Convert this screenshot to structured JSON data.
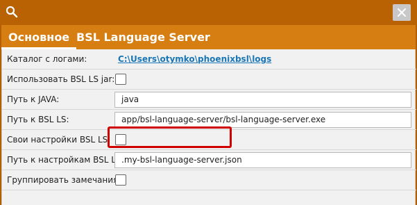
{
  "window": {
    "accent_color": "#b96203",
    "tab_color": "#d67e11",
    "highlight_color": "#d00000",
    "icons": {
      "search": "search-icon",
      "close": "close-icon"
    }
  },
  "tabs": [
    {
      "label": "Основное",
      "active": true
    },
    {
      "label": "BSL Language Server",
      "active": false
    }
  ],
  "form": {
    "logs_label": "Каталог с логами:",
    "logs_link": "C:\\Users\\otymko\\phoenixbsl\\logs",
    "use_jar_label": "Использовать BSL LS jar:",
    "use_jar_checked": false,
    "java_path_label": "Путь к JAVA:",
    "java_path_value": "java",
    "bsl_ls_path_label": "Путь к BSL LS:",
    "bsl_ls_path_value": "app/bsl-language-server/bsl-language-server.exe",
    "custom_settings_label": "Свои настройки BSL LS:",
    "custom_settings_checked": false,
    "settings_path_label": "Путь к настройкам BSL LS:",
    "settings_path_value": ".my-bsl-language-server.json",
    "group_issues_label": "Группировать замечания:",
    "group_issues_checked": false
  }
}
